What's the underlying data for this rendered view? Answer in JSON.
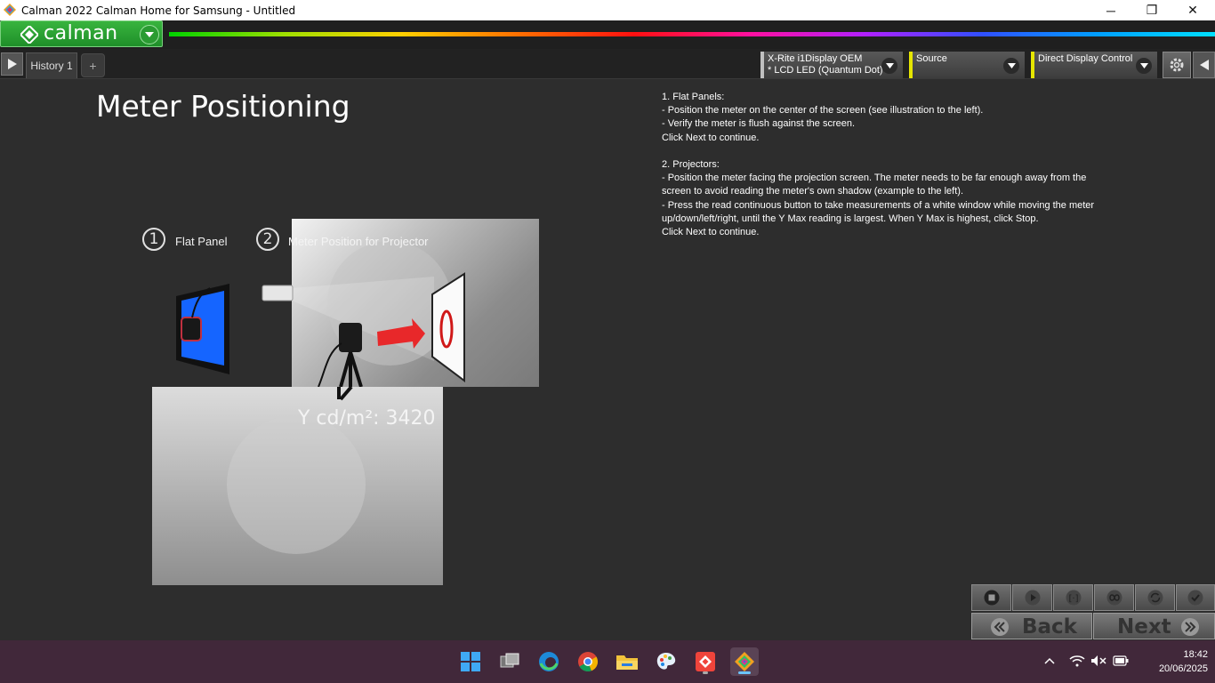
{
  "window": {
    "title": "Calman 2022 Calman Home for Samsung  - Untitled",
    "minimize": "─",
    "maximize": "❐",
    "close": "✕"
  },
  "header": {
    "brand": "calman"
  },
  "toolbar": {
    "tab_label": "History 1",
    "add_tab": "+",
    "meter": {
      "line1": "X-Rite i1Display OEM",
      "line2": "* LCD LED (Quantum Dot)"
    },
    "source": {
      "label": "Source"
    },
    "display_control": {
      "label": "Direct Display Control"
    }
  },
  "page": {
    "heading": "Meter Positioning",
    "instructions": "1. Flat Panels:\n- Position the meter on the center of the screen (see illustration to the left).\n- Verify the meter is flush against the screen.\nClick Next to continue.\n\n2. Projectors:\n- Position the meter facing the projection screen. The meter needs to be far enough away from the\nscreen to avoid reading the meter's own shadow (example to the left).\n- Press the read continuous button to take measurements of a white window while moving the meter\nup/down/left/right, until the Y Max reading is largest. When Y Max is highest, click Stop.\nClick Next to continue.",
    "illustration": {
      "step1_num": "1",
      "step1_label": "Flat Panel",
      "step2_num": "2",
      "step2_label": "Meter Position for Projector",
      "reading": "Y cd/m²: 3420"
    }
  },
  "controls": {
    "back": "Back",
    "next": "Next"
  },
  "taskbar": {
    "time": "18:42",
    "date": "20/06/2025"
  },
  "colors": {
    "accent_green": "#38b43e",
    "source_marker": "#e6e600",
    "taskbar": "#41283a"
  }
}
